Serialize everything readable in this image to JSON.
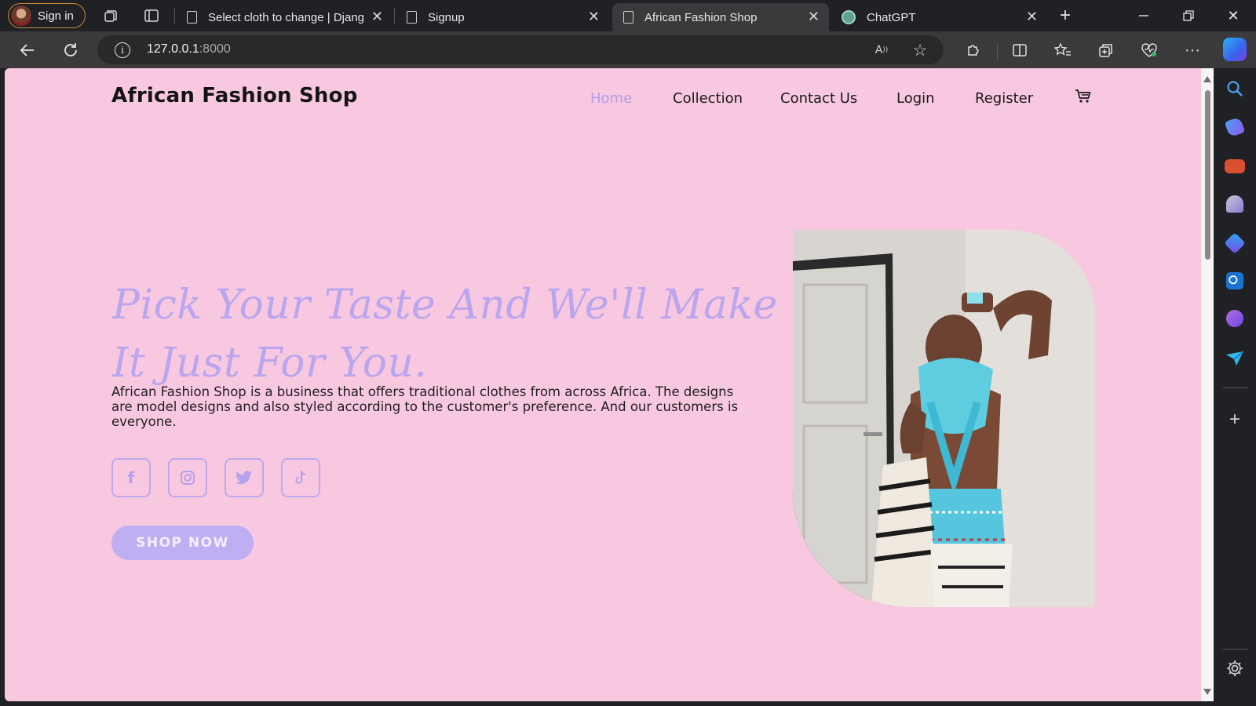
{
  "browser": {
    "signin_label": "Sign in",
    "tabs": [
      {
        "title": "Select cloth to change | Djang",
        "active": false
      },
      {
        "title": "Signup",
        "active": false
      },
      {
        "title": "African Fashion Shop",
        "active": true
      },
      {
        "title": "ChatGPT",
        "active": false
      }
    ],
    "address": {
      "host": "127.0.0.1",
      "port": ":8000"
    }
  },
  "page": {
    "brand": "African Fashion Shop",
    "nav": [
      "Home",
      "Collection",
      "Contact Us",
      "Login",
      "Register"
    ],
    "active_nav": "Home",
    "hero": {
      "title": "Pick Your Taste And We'll Make It Just For You.",
      "description": "African Fashion Shop is a business that offers traditional clothes from across Africa. The designs are model designs and also styled according to the customer's preference. And our customers is everyone.",
      "cta": "SHOP NOW"
    },
    "social_icons": [
      "facebook-icon",
      "instagram-icon",
      "twitter-icon",
      "tiktok-icon"
    ]
  },
  "colors": {
    "page_background": "#f8c8e0",
    "accent": "#b9a6ee",
    "browser_chrome": "#202124"
  }
}
